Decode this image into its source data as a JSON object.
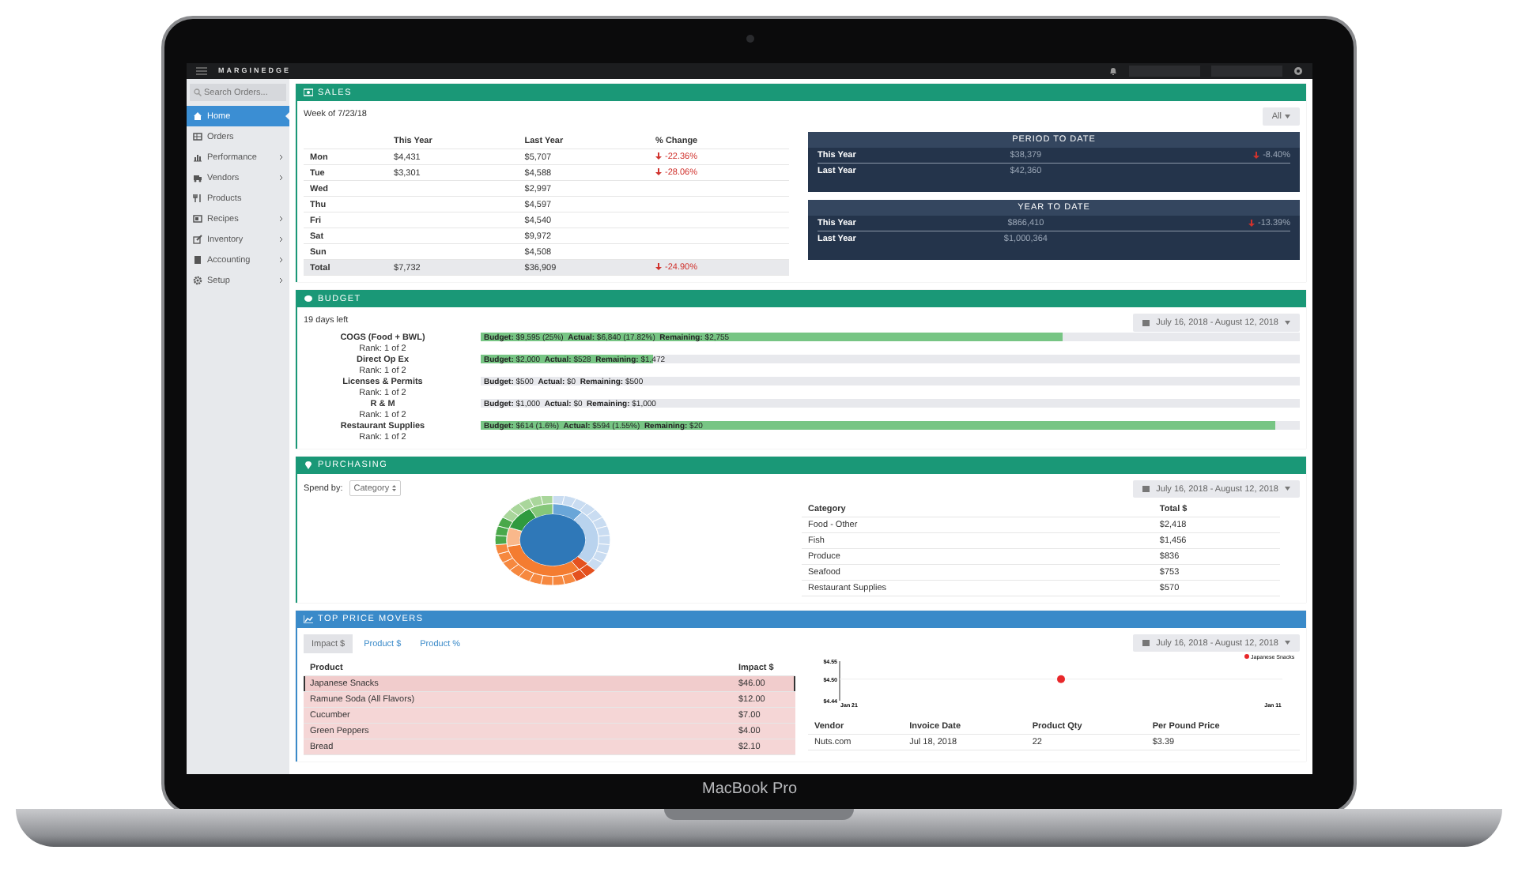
{
  "topbar": {
    "logo": "MARGINEDGE"
  },
  "sidebar": {
    "search_placeholder": "Search Orders...",
    "items": [
      {
        "label": "Home",
        "selected": true,
        "submenu": false
      },
      {
        "label": "Orders",
        "selected": false,
        "submenu": false
      },
      {
        "label": "Performance",
        "selected": false,
        "submenu": true
      },
      {
        "label": "Vendors",
        "selected": false,
        "submenu": true
      },
      {
        "label": "Products",
        "selected": false,
        "submenu": false
      },
      {
        "label": "Recipes",
        "selected": false,
        "submenu": true
      },
      {
        "label": "Inventory",
        "selected": false,
        "submenu": true
      },
      {
        "label": "Accounting",
        "selected": false,
        "submenu": true
      },
      {
        "label": "Setup",
        "selected": false,
        "submenu": true
      }
    ]
  },
  "sales": {
    "title": "SALES",
    "week": "Week of 7/23/18",
    "filter": "All",
    "columns": [
      "This Year",
      "Last Year",
      "% Change"
    ],
    "rows": [
      {
        "kind": "day",
        "day": "Mon",
        "this_year": "$4,431",
        "last_year": "$5,707",
        "change": "-22.36%"
      },
      {
        "kind": "day",
        "day": "Tue",
        "this_year": "$3,301",
        "last_year": "$4,588",
        "change": "-28.06%"
      },
      {
        "kind": "day",
        "day": "Wed",
        "last_year": "$2,997"
      },
      {
        "kind": "day",
        "day": "Thu",
        "last_year": "$4,597"
      },
      {
        "kind": "day",
        "day": "Fri",
        "last_year": "$4,540"
      },
      {
        "kind": "day",
        "day": "Sat",
        "last_year": "$9,972"
      },
      {
        "kind": "day",
        "day": "Sun",
        "last_year": "$4,508"
      },
      {
        "kind": "total",
        "day": "Total",
        "this_year": "$7,732",
        "last_year": "$36,909",
        "change": "-24.90%"
      }
    ],
    "panels": [
      {
        "title": "PERIOD TO DATE",
        "rows": [
          {
            "label": "This Year",
            "value": "$38,379",
            "change": "-8.40%"
          },
          {
            "label": "Last Year",
            "value": "$42,360"
          }
        ]
      },
      {
        "title": "YEAR TO DATE",
        "rows": [
          {
            "label": "This Year",
            "value": "$866,410",
            "change": "-13.39%"
          },
          {
            "label": "Last Year",
            "value": "$1,000,364"
          }
        ]
      }
    ]
  },
  "budget": {
    "title": "BUDGET",
    "days_left": "19 days left",
    "date_range": "July 16, 2018 - August 12, 2018",
    "items": [
      {
        "name": "COGS (Food + BWL)",
        "rank": "Rank: 1 of 2",
        "bar_text": "**Budget:** $9,595 (25%)  **Actual:** $6,840 (17.82%)  **Remaining:** $2,755",
        "level": 0.71
      },
      {
        "name": "Direct Op Ex",
        "rank": "Rank: 1 of 2",
        "bar_text": "**Budget:** $2,000  **Actual:** $528  **Remaining:** $1,472",
        "level": 0.21
      },
      {
        "name": "Licenses & Permits",
        "rank": "Rank: 1 of 2",
        "bar_text": "**Budget:** $500  **Actual:** $0  **Remaining:** $500",
        "level": 0
      },
      {
        "name": "R & M",
        "rank": "Rank: 1 of 2",
        "bar_text": "**Budget:** $1,000  **Actual:** $0  **Remaining:** $1,000",
        "level": 0
      },
      {
        "name": "Restaurant Supplies",
        "rank": "Rank: 1 of 2",
        "bar_text": "**Budget:** $614 (1.6%)  **Actual:** $594 (1.55%)  **Remaining:** $20",
        "level": 0.97
      }
    ]
  },
  "purchasing": {
    "title": "PURCHASING",
    "spend_by_label": "Spend by:",
    "spend_by": "Category",
    "date_range": "July 16, 2018 - August 12, 2018",
    "columns": [
      "Category",
      "Total $"
    ],
    "rows": [
      [
        "Food - Other",
        "$2,418"
      ],
      [
        "Fish",
        "$1,456"
      ],
      [
        "Produce",
        "$836"
      ],
      [
        "Seafood",
        "$753"
      ],
      [
        "Restaurant Supplies",
        "$570"
      ]
    ]
  },
  "price_movers": {
    "title": "TOP PRICE MOVERS",
    "tabs": [
      {
        "label": "Impact $",
        "selected": true
      },
      {
        "label": "Product $",
        "selected": false
      },
      {
        "label": "Product %",
        "selected": false
      }
    ],
    "date_range": "July 16, 2018 - August 12, 2018",
    "columns": [
      "Product",
      "Impact $"
    ],
    "rows": [
      {
        "product": "Japanese Snacks",
        "impact": "$46.00",
        "selected": true
      },
      {
        "product": "Ramune Soda (All Flavors)",
        "impact": "$12.00",
        "selected": false
      },
      {
        "product": "Cucumber",
        "impact": "$7.00",
        "selected": false
      },
      {
        "product": "Green Peppers",
        "impact": "$4.00",
        "selected": false
      },
      {
        "product": "Bread",
        "impact": "$2.10",
        "selected": false
      }
    ],
    "chart_data": {
      "type": "scatter",
      "categories": [
        "Jan 21",
        null,
        "Jan 11"
      ],
      "series": [
        {
          "name": "Japanese Snacks",
          "color": "#e8272a",
          "values": [
            null,
            4.5,
            null
          ]
        }
      ],
      "ylim": [
        4.44,
        4.55
      ],
      "yticks": [
        {
          "value": 4.55,
          "label": "$4.55"
        },
        {
          "value": 4.5,
          "label": "$4.50"
        },
        {
          "value": 4.44,
          "label": "$4.44"
        }
      ]
    },
    "invoice_columns": [
      "Vendor",
      "Invoice Date",
      "Product Qty",
      "Per Pound Price"
    ],
    "invoice_rows": [
      [
        "Nuts.com",
        "Jul 18, 2018",
        "22",
        "$3.39"
      ]
    ]
  },
  "device": {
    "label": "MacBook Pro"
  }
}
